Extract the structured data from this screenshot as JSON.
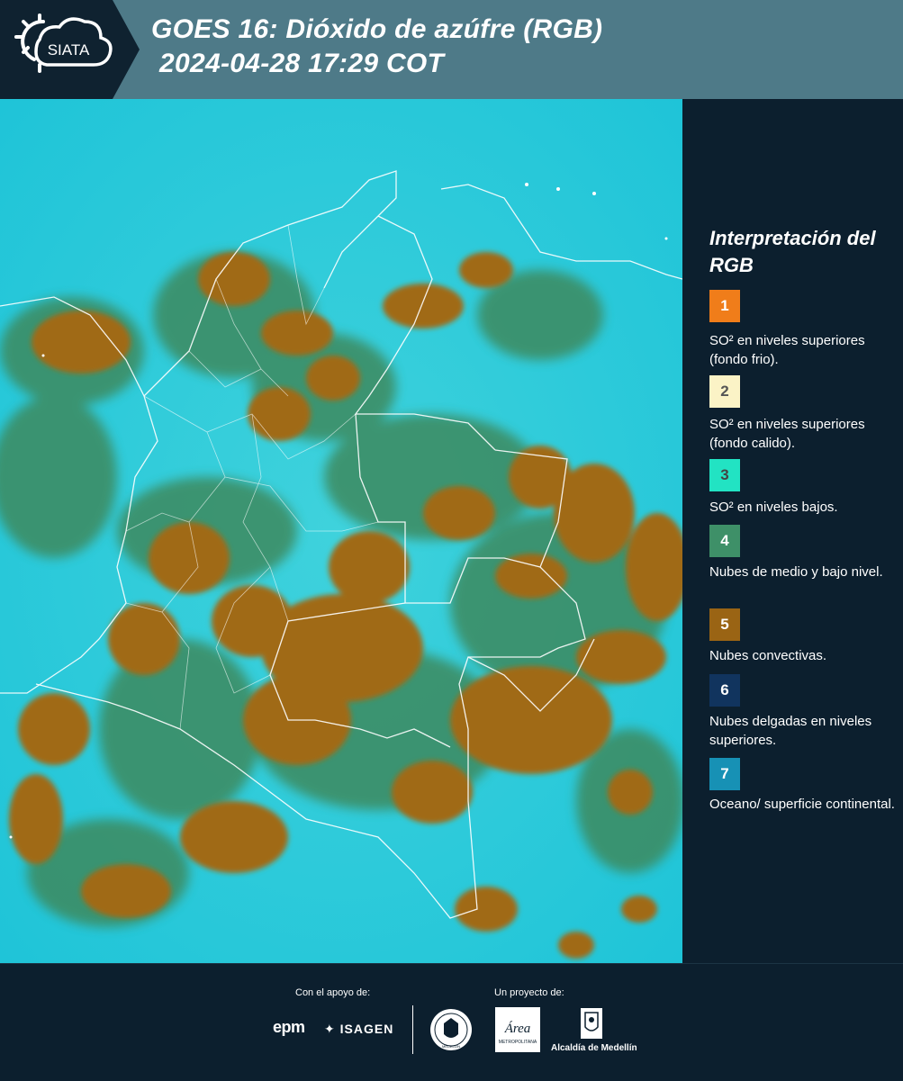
{
  "header": {
    "logo_text": "SIATA",
    "title_line1": "GOES 16: Dióxido de azúfre (RGB)",
    "title_line2": "2024-04-28 17:29 COT"
  },
  "legend": {
    "title": "Interpretación del RGB",
    "items": [
      {
        "num": "1",
        "color": "#f07d1a",
        "num_color": "#ffffff",
        "text": "SO² en niveles superiores (fondo frio)."
      },
      {
        "num": "2",
        "color": "#fbf3c6",
        "num_color": "#555555",
        "text": "SO² en niveles superiores (fondo calido)."
      },
      {
        "num": "3",
        "color": "#22e3c3",
        "num_color": "#444444",
        "text": "SO² en niveles bajos."
      },
      {
        "num": "4",
        "color": "#3e9068",
        "num_color": "#ffffff",
        "text": "Nubes de medio y bajo nivel."
      },
      {
        "num": "5",
        "color": "#9a6414",
        "num_color": "#ffffff",
        "text": "Nubes convectivas."
      },
      {
        "num": "6",
        "color": "#11345e",
        "num_color": "#ffffff",
        "text": "Nubes delgadas en niveles superiores."
      },
      {
        "num": "7",
        "color": "#1791b5",
        "num_color": "#ffffff",
        "text": "Oceano/ superficie continental."
      }
    ]
  },
  "footer": {
    "support_label": "Con el apoyo de:",
    "project_label": "Un proyecto de:",
    "sponsor_1": "epm",
    "sponsor_2": "ISAGEN",
    "partner_seal_text": "MEDELLÍN",
    "partner_area": "Área",
    "partner_area_sub": "METROPOLITANA",
    "partner_alcaldia": "Alcaldía de Medellín"
  },
  "colors": {
    "header_bg": "#4e7a88",
    "panel_bg": "#0c1f2e",
    "map_background": "#2ad0e0",
    "convective_cloud": "#9a6414",
    "low_cloud": "#3e9068"
  }
}
